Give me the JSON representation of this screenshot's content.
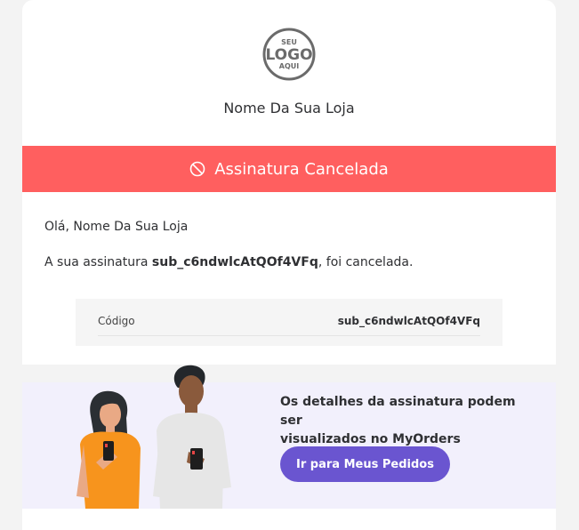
{
  "logo": {
    "top_text": "SEU",
    "main_text": "LOGO",
    "bottom_text": "AQUI"
  },
  "header": {
    "store_name": "Nome Da Sua Loja"
  },
  "banner": {
    "icon": "cancel-icon",
    "title": "Assinatura Cancelada",
    "color": "#ff5f5f"
  },
  "body": {
    "greeting": "Olá, Nome Da Sua Loja",
    "message_prefix": "A sua assinatura ",
    "subscription_id": "sub_c6ndwlcAtQOf4VFq",
    "message_suffix": ", foi cancelada."
  },
  "details": {
    "label": "Código",
    "value": "sub_c6ndwlcAtQOf4VFq"
  },
  "promo": {
    "text_line1": "Os detalhes da assinatura podem ser",
    "text_line2": "visualizados no MyOrders",
    "button_label": "Ir para Meus Pedidos",
    "button_color": "#6a55d0",
    "background": "#f2f0fc"
  }
}
